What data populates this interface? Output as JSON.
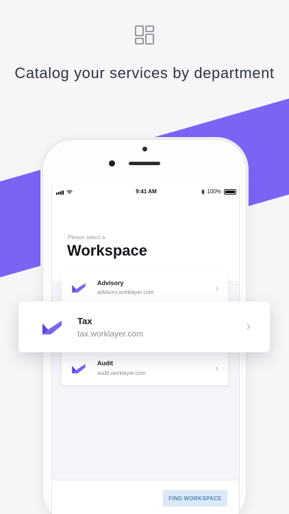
{
  "headline": "Catalog your services by department",
  "icons": {
    "top": "dashboard-layout-icon",
    "logo": "worklayer-logo-icon",
    "chevron": "chevron-right-icon"
  },
  "colors": {
    "brand": "#7a64f5",
    "button_bg": "#dbe9f6",
    "button_text": "#5a86b5"
  },
  "status_bar": {
    "time": "9:41 AM",
    "battery": "100%"
  },
  "screen": {
    "subtitle": "Please select a",
    "title": "Workspace"
  },
  "workspaces": [
    {
      "name": "Advisory",
      "url": "advisory.worklayer.com"
    },
    {
      "name": "Tax",
      "url": "tax.worklayer.com"
    },
    {
      "name": "Audit",
      "url": "audit.worklayer.com"
    }
  ],
  "find_button": "FIND WORKSPACE"
}
